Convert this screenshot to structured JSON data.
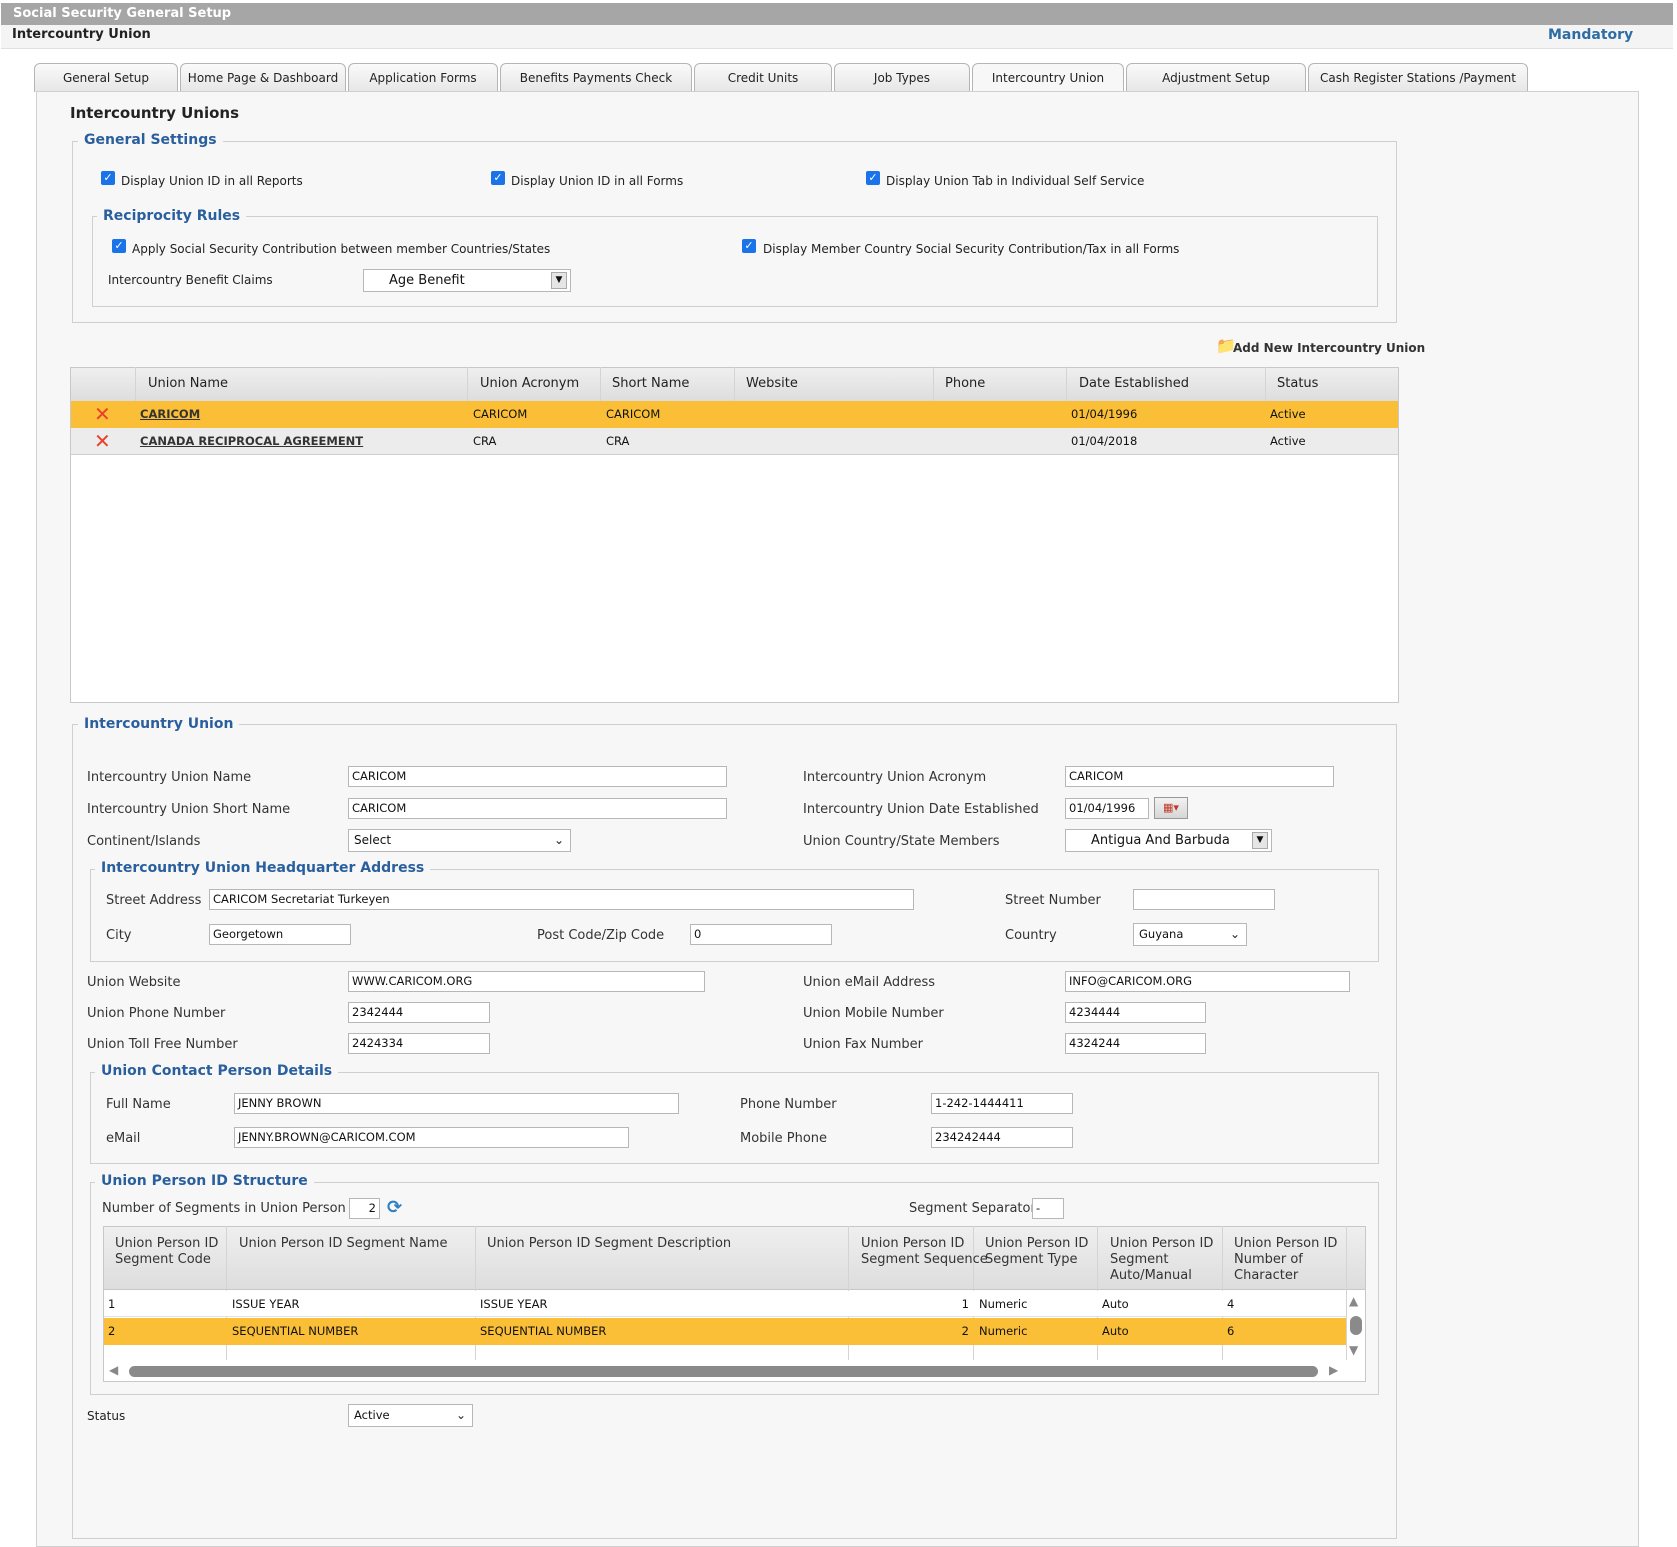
{
  "app": {
    "title": "Social Security General Setup",
    "subtitle": "Intercountry Union",
    "mandatory": "Mandatory"
  },
  "tabs": [
    {
      "label": "General Setup"
    },
    {
      "label": "Home Page & Dashboard"
    },
    {
      "label": "Application Forms"
    },
    {
      "label": "Benefits Payments Check Printers"
    },
    {
      "label": "Credit Units"
    },
    {
      "label": "Job Types"
    },
    {
      "label": "Intercountry Union"
    },
    {
      "label": "Adjustment Setup"
    },
    {
      "label": "Cash Register Stations /Payment Setup"
    }
  ],
  "page_heading": "Intercountry Unions",
  "general_settings": {
    "legend": "General Settings",
    "checks": [
      {
        "label": "Display Union ID in all Reports",
        "checked": true
      },
      {
        "label": "Display Union ID in all Forms",
        "checked": true
      },
      {
        "label": "Display Union Tab in Individual Self Service",
        "checked": true
      }
    ],
    "reciprocity": {
      "legend": "Reciprocity Rules",
      "checks": [
        {
          "label": "Apply Social Security Contribution between member Countries/States",
          "checked": true
        },
        {
          "label": "Display Member Country Social Security Contribution/Tax in all Forms",
          "checked": true
        }
      ],
      "claims_label": "Intercountry Benefit Claims",
      "claims_value": "Age Benefit"
    }
  },
  "add_new": "Add New Intercountry Union",
  "union_grid": {
    "columns": [
      "Union Name",
      "Union Acronym",
      "Short Name",
      "Website",
      "Phone",
      "Date Established",
      "Status"
    ],
    "rows": [
      {
        "name": "CARICOM",
        "acronym": "CARICOM",
        "short": "CARICOM",
        "website": "",
        "phone": "",
        "date": "01/04/1996",
        "status": "Active",
        "selected": true
      },
      {
        "name": "CANADA RECIPROCAL AGREEMENT",
        "acronym": "CRA",
        "short": "CRA",
        "website": "",
        "phone": "",
        "date": "01/04/2018",
        "status": "Active",
        "selected": false
      }
    ]
  },
  "form": {
    "legend": "Intercountry Union",
    "name_label": "Intercountry Union Name",
    "name_value": "CARICOM",
    "acronym_label": "Intercountry Union Acronym",
    "acronym_value": "CARICOM",
    "short_label": "Intercountry Union Short Name",
    "short_value": "CARICOM",
    "date_label": "Intercountry Union Date Established",
    "date_value": "01/04/1996",
    "continent_label": "Continent/Islands",
    "continent_value": "Select",
    "members_label": "Union Country/State Members",
    "members_value": "Antigua And Barbuda",
    "hq": {
      "legend": "Intercountry Union Headquarter Address",
      "street_label": "Street Address",
      "street_value": "CARICOM Secretariat Turkeyen",
      "number_label": "Street Number",
      "number_value": "",
      "city_label": "City",
      "city_value": "Georgetown",
      "post_label": "Post Code/Zip Code",
      "post_value": "0",
      "country_label": "Country",
      "country_value": "Guyana"
    },
    "website_label": "Union Website",
    "website_value": "WWW.CARICOM.ORG",
    "email_label": "Union eMail Address",
    "email_value": "INFO@CARICOM.ORG",
    "phone_label": "Union Phone Number",
    "phone_value": "2342444",
    "mobile_label": "Union Mobile Number",
    "mobile_value": "4234444",
    "tollfree_label": "Union Toll Free Number",
    "tollfree_value": "2424334",
    "fax_label": "Union Fax Number",
    "fax_value": "4324244",
    "contact": {
      "legend": "Union Contact Person Details",
      "fullname_label": "Full Name",
      "fullname_value": "JENNY BROWN",
      "cphone_label": "Phone Number",
      "cphone_value": "1-242-1444411",
      "email_label": "eMail",
      "email_value": "JENNY.BROWN@CARICOM.COM",
      "cmobile_label": "Mobile Phone",
      "cmobile_value": "234242444"
    },
    "idstruct": {
      "legend": "Union Person ID Structure",
      "segments_label": "Number of Segments in Union Person ID",
      "segments_value": "2",
      "separator_label": "Segment Separator",
      "separator_value": "-",
      "columns": [
        [
          "Union Person ID",
          "Segment Code"
        ],
        [
          "Union Person ID Segment Name"
        ],
        [
          "Union Person ID Segment Description"
        ],
        [
          "Union Person ID",
          "Segment Sequence"
        ],
        [
          "Union Person ID",
          "Segment Type"
        ],
        [
          "Union Person ID",
          "Segment",
          "Auto/Manual"
        ],
        [
          "Union Person ID",
          "Number of",
          "Character"
        ]
      ],
      "rows": [
        {
          "code": "1",
          "name": "ISSUE YEAR",
          "desc": "ISSUE YEAR",
          "seq": "1",
          "type": "Numeric",
          "auto": "Auto",
          "chars": "4",
          "selected": false
        },
        {
          "code": "2",
          "name": "SEQUENTIAL NUMBER",
          "desc": "SEQUENTIAL NUMBER",
          "seq": "2",
          "type": "Numeric",
          "auto": "Auto",
          "chars": "6",
          "selected": true
        }
      ]
    },
    "status_label": "Status",
    "status_value": "Active"
  },
  "colors": {
    "accent": "#2a5f9e",
    "selected_row": "#fbbf37",
    "delete": "#e8412c"
  }
}
